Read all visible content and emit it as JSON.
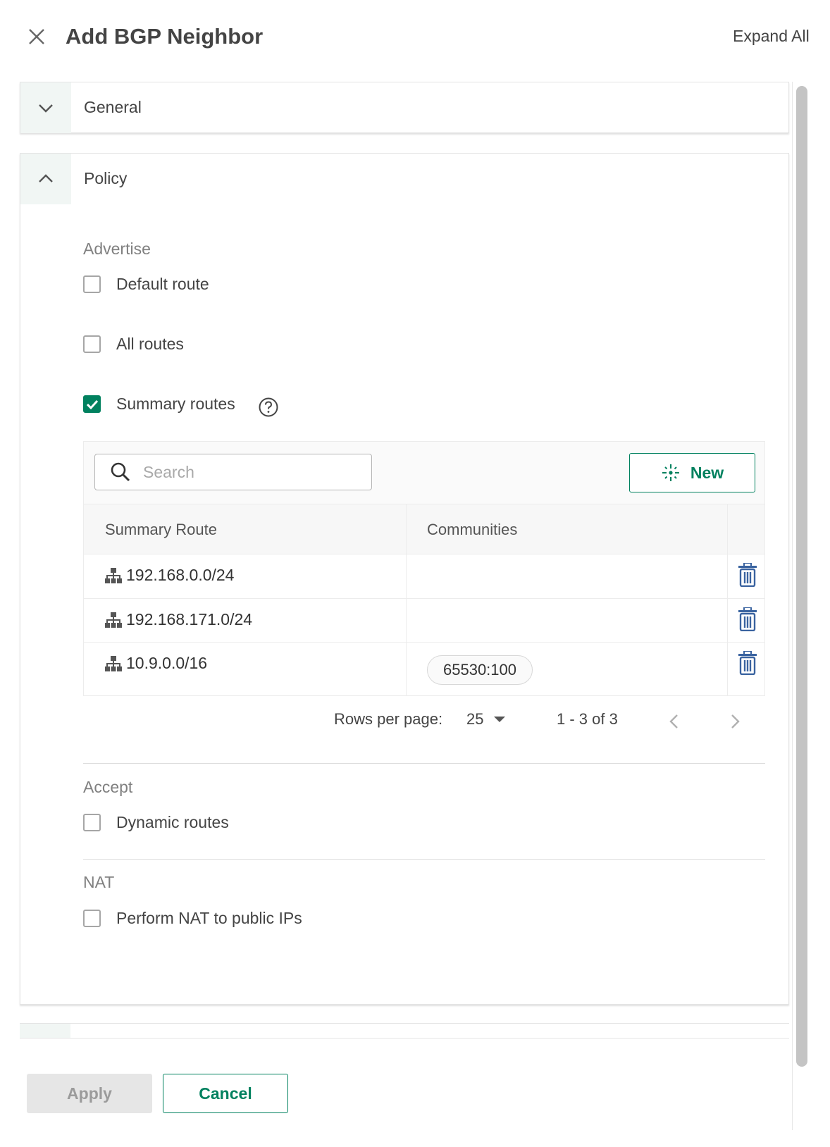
{
  "header": {
    "title": "Add BGP Neighbor",
    "close_icon": "close-icon",
    "expand_all_label": "Expand All"
  },
  "panels": {
    "general": {
      "label": "General",
      "state": "collapsed"
    },
    "policy": {
      "label": "Policy",
      "state": "expanded"
    }
  },
  "advertise": {
    "label": "Advertise",
    "options": [
      {
        "label": "Default route",
        "checked": false
      },
      {
        "label": "All routes",
        "checked": false
      },
      {
        "label": "Summary routes",
        "checked": true
      }
    ]
  },
  "summary_table": {
    "search_placeholder": "Search",
    "new_label": "New",
    "columns": [
      "Summary Route",
      "Communities"
    ],
    "rows": [
      {
        "route": "192.168.0.0/24",
        "communities": ""
      },
      {
        "route": "192.168.171.0/24",
        "communities": ""
      },
      {
        "route": "10.9.0.0/16",
        "communities": "65530:100"
      }
    ],
    "pagination": {
      "rows_per_page_label": "Rows per page:",
      "rows_per_page": "25",
      "range": "1 - 3 of 3"
    }
  },
  "accept": {
    "label": "Accept",
    "options": [
      {
        "label": "Dynamic routes",
        "checked": false
      }
    ]
  },
  "nat": {
    "label": "NAT",
    "options": [
      {
        "label": "Perform NAT to public IPs",
        "checked": false
      }
    ]
  },
  "footer": {
    "apply_label": "Apply",
    "cancel_label": "Cancel"
  },
  "colors": {
    "accent": "#01815f",
    "icon_blue": "#3a63a0",
    "toggle_bg": "#f1f6f4"
  }
}
